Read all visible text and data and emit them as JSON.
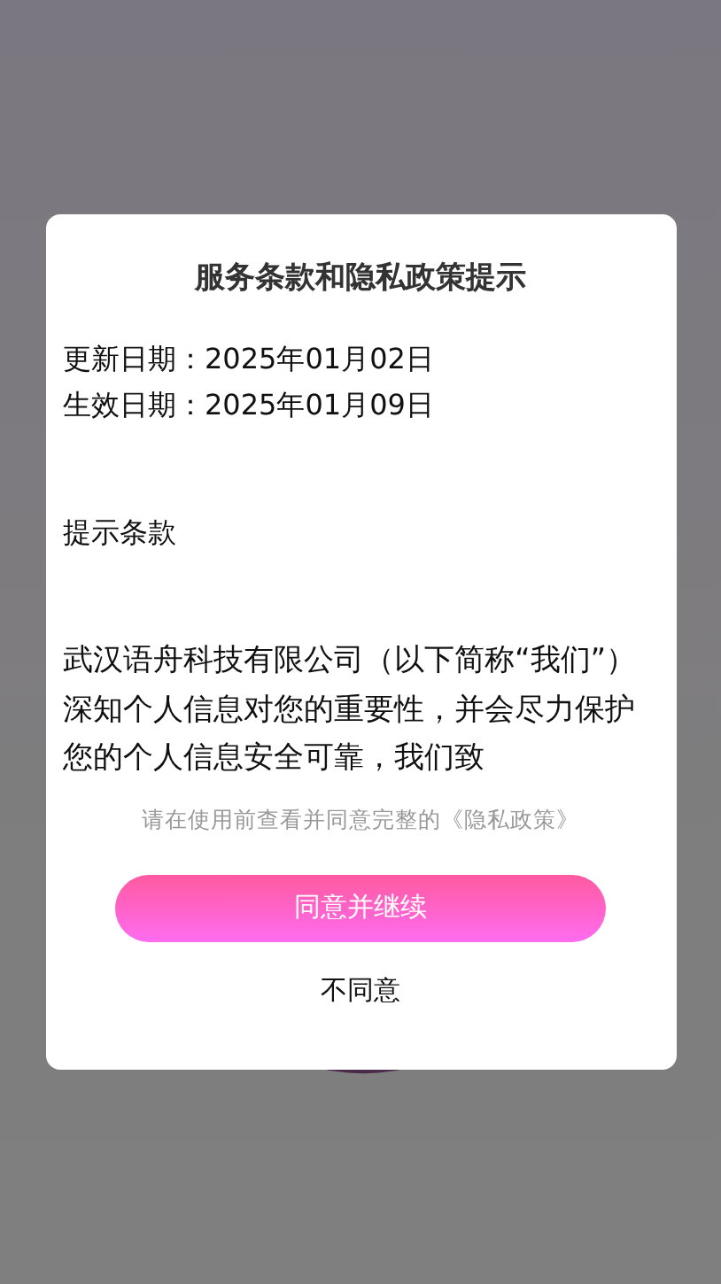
{
  "dialog": {
    "title": "服务条款和隐私政策提示",
    "dates": [
      "更新日期：2025年01月02日",
      "生效日期：2025年01月09日"
    ],
    "section_heading": "提示条款",
    "paragraph": "武汉语舟科技有限公司（以下简称“我们”）深知个人信息对您的重要性，并会尽力保护您的个人信息安全可靠，我们致",
    "notice": "请在使用前查看并同意完整的《隐私政策》",
    "agree_button": "同意并继续",
    "decline_button": "不同意"
  }
}
